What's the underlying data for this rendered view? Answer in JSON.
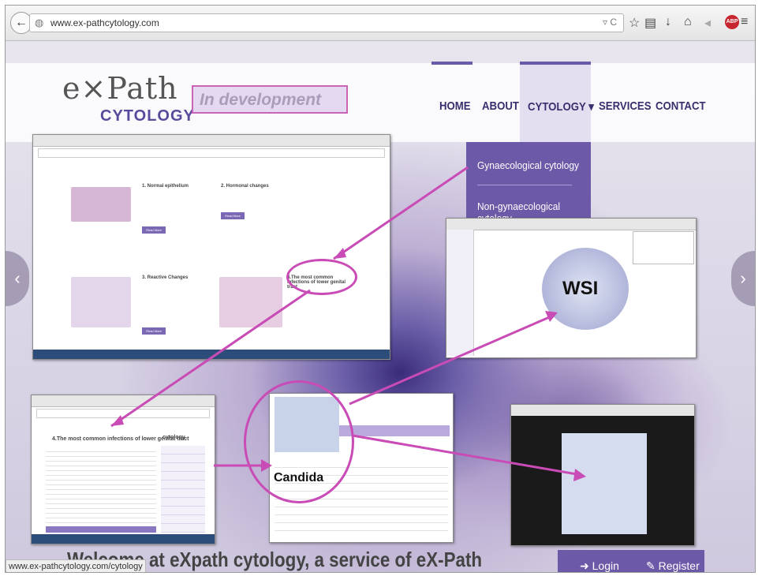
{
  "browser": {
    "url": "www.ex-pathcytology.com",
    "status_url": "www.ex-pathcytology.com/cytology"
  },
  "site": {
    "logo_top": "e×Path",
    "logo_bottom": "CYTOLOGY",
    "dev_badge": "In development",
    "nav": [
      "HOME",
      "ABOUT",
      "CYTOLOGY ▾",
      "SERVICES",
      "CONTACT"
    ],
    "dropdown": [
      "Gynaecological cytology",
      "Non-gynaecological cytology"
    ],
    "welcome": "Welcome at eXpath cytology, a service of eX-Path",
    "login": "Login",
    "register": "Register"
  },
  "shot1": {
    "cards": [
      {
        "title": "1. Normal epithelium"
      },
      {
        "title": "2. Hormonal changes"
      },
      {
        "title": "3. Reactive Changes"
      },
      {
        "title": "4.The most common infections of lower genital tract"
      }
    ],
    "read_more": "Read More"
  },
  "shot3": {
    "title": "4.The most common infections of lower genital tract",
    "sidebar_title": "cytology"
  },
  "annotations": {
    "wsi": "WSI",
    "candida": "Candida"
  },
  "colors": {
    "brand": "#6c5aa8",
    "annotation": "#c94bb5"
  }
}
